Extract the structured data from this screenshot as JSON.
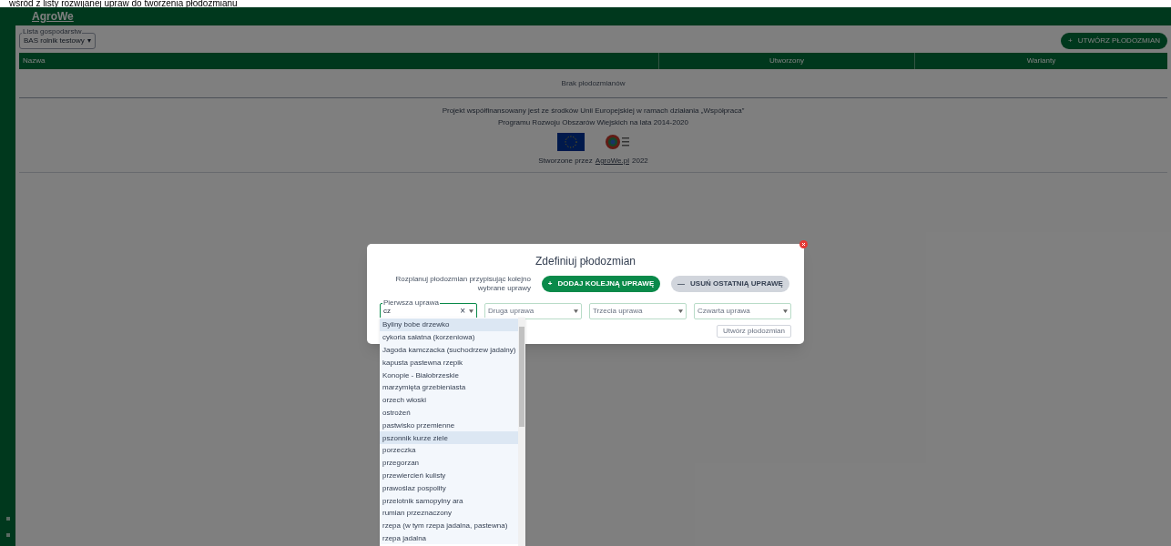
{
  "caption": "wśród z listy rozwijanej upraw do tworzenia płodozmianu",
  "header": {
    "logo": "AgroWe"
  },
  "farm_select": {
    "label": "Lista gospodarstw",
    "value": "BAS rolnik testowy",
    "caret": "▾"
  },
  "create_button": {
    "icon": "+",
    "label": "UTWÓRZ PŁODOZMIAN"
  },
  "table": {
    "columns": [
      "Nazwa",
      "Utworzony",
      "Warianty"
    ],
    "empty_text": "Brak płodozmianów"
  },
  "footer": {
    "lines": [
      "Projekt współfinansowany jest ze środków Unii Europejskiej w ramach działania „Współpraca”",
      "Programu Rozwoju Obszarów Wiejskich na lata 2014-2020"
    ],
    "credit": "Stworzone przez",
    "credit_link": "AgroWe.pl",
    "credit_year": "2022"
  },
  "modal": {
    "title": "Zdefiniuj płodozmian",
    "description": "Rozplanuj płodozmian przypisując kolejno wybrane uprawy",
    "add_button": {
      "icon": "+",
      "label": "DODAJ KOLEJNĄ UPRAWĘ",
      "disabled": false
    },
    "remove_button": {
      "icon": "—",
      "label": "USUŃ OSTATNIĄ UPRAWĘ",
      "disabled": true
    },
    "selects": [
      {
        "label": "Pierwsza uprawa",
        "value": "cz",
        "clear_icon": "×",
        "focused": true
      },
      {
        "placeholder": "Druga uprawa",
        "focused": false
      },
      {
        "placeholder": "Trzecia uprawa",
        "focused": false
      },
      {
        "placeholder": "Czwarta uprawa",
        "focused": false
      }
    ],
    "submit_button": {
      "label": "Utwórz płodozmian",
      "disabled": true
    },
    "options": [
      {
        "label": "Byliny bobe drzewko",
        "highlighted": true
      },
      {
        "label": "cykoria sałatna (korzeniowa)",
        "highlighted": false
      },
      {
        "label": "Jagoda kamczacka (suchodrzew jadalny)",
        "highlighted": false
      },
      {
        "label": "kapusta pastewna rzepik",
        "highlighted": false
      },
      {
        "label": "Konopie - Białobrzeskie",
        "highlighted": false
      },
      {
        "label": "marzymięta grzebieniasta",
        "highlighted": false
      },
      {
        "label": "orzech włoski",
        "highlighted": false
      },
      {
        "label": "ostrożeń",
        "highlighted": false
      },
      {
        "label": "pastwisko przemienne",
        "highlighted": false
      },
      {
        "label": "pszonnik kurze ziele",
        "highlighted": true
      },
      {
        "label": "porzeczka",
        "highlighted": false
      },
      {
        "label": "przegorzan",
        "highlighted": false
      },
      {
        "label": "przewiercień kulisty",
        "highlighted": false
      },
      {
        "label": "prawoślaz pospolity",
        "highlighted": false
      },
      {
        "label": "przelotnik samopylny ara",
        "highlighted": false
      },
      {
        "label": "rumian przeznaczony",
        "highlighted": false
      },
      {
        "label": "rzepa (w tym rzepa jadalna, pastewna)",
        "highlighted": false
      },
      {
        "label": "rzepa jadalna",
        "highlighted": false
      }
    ]
  }
}
